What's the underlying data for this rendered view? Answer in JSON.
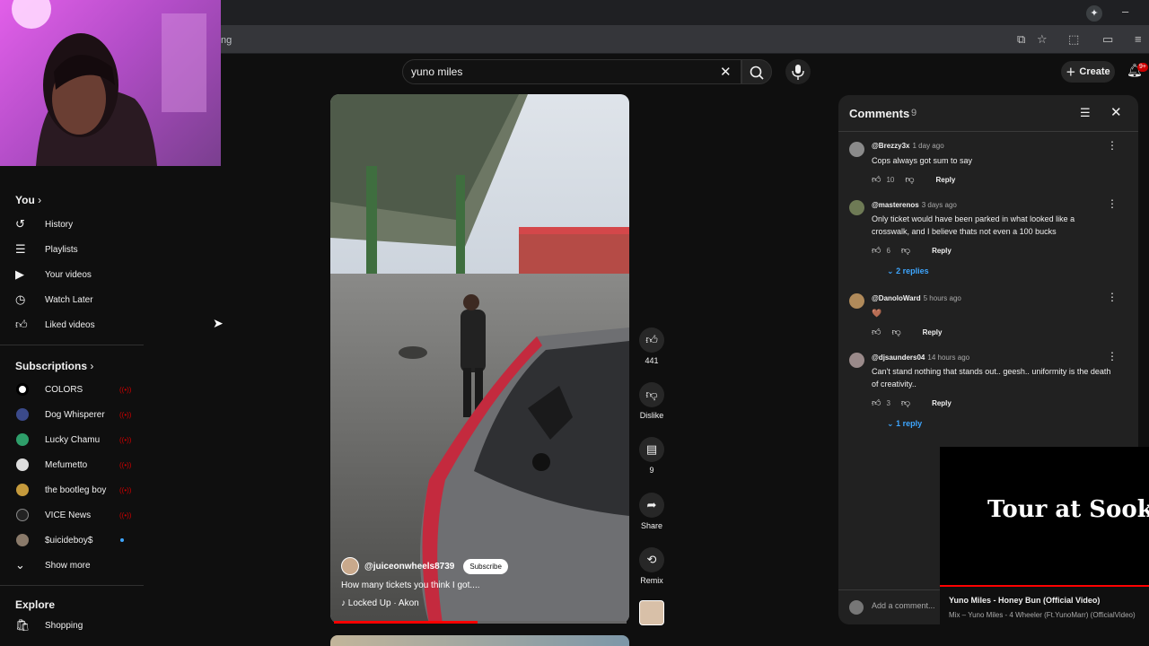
{
  "browser": {
    "address_fragment": "ng"
  },
  "header": {
    "search_value": "yuno miles",
    "create_label": "Create",
    "notification_badge": "9+"
  },
  "sidebar": {
    "you_label": "You",
    "you_items": [
      {
        "label": "History",
        "icon": "history-icon"
      },
      {
        "label": "Playlists",
        "icon": "playlists-icon"
      },
      {
        "label": "Your videos",
        "icon": "your-videos-icon"
      },
      {
        "label": "Watch Later",
        "icon": "clock-icon"
      },
      {
        "label": "Liked videos",
        "icon": "thumbs-up-icon"
      }
    ],
    "subscriptions_label": "Subscriptions",
    "subscriptions": [
      {
        "label": "COLORS",
        "avatar_color": "#ffffff",
        "indicator": "live"
      },
      {
        "label": "Dog Whisperer",
        "avatar_color": "#3b4a8a",
        "indicator": "live"
      },
      {
        "label": "Lucky Chamu",
        "avatar_color": "#2e9e6a",
        "indicator": "live"
      },
      {
        "label": "Mefumetto",
        "avatar_color": "#dddddd",
        "indicator": "live"
      },
      {
        "label": "the bootleg boy",
        "avatar_color": "#c59a3c",
        "indicator": "live"
      },
      {
        "label": "VICE News",
        "avatar_color": "#222222",
        "indicator": "live"
      },
      {
        "label": "$uicideboy$",
        "avatar_color": "#8a7a6a",
        "indicator": "new"
      }
    ],
    "show_more_label": "Show more",
    "explore_label": "Explore",
    "explore_items": [
      {
        "label": "Shopping",
        "icon": "shopping-bag-icon"
      }
    ]
  },
  "short": {
    "channel": "@juiceonwheels8739",
    "subscribe_label": "Subscribe",
    "title": "How many tickets you think I got....",
    "music": "Locked Up · Akon",
    "progress": 0.49,
    "actions": {
      "likes": "441",
      "dislike_label": "Dislike",
      "comments": "9",
      "share_label": "Share",
      "remix_label": "Remix"
    }
  },
  "comments_panel": {
    "title": "Comments",
    "count": "9",
    "items": [
      {
        "user": "@Brezzy3x",
        "time": "1 day ago",
        "text": "Cops always got sum to say",
        "likes": "10",
        "reply_label": "Reply",
        "avatar_color": "#8a8a8a"
      },
      {
        "user": "@masterenos",
        "time": "3 days ago",
        "text": "Only ticket would have been parked in what looked like a crosswalk, and I believe thats not even a 100 bucks",
        "likes": "6",
        "reply_label": "Reply",
        "replies": "2 replies",
        "avatar_color": "#6e7a55"
      },
      {
        "user": "@DanoloWard",
        "time": "5 hours ago",
        "text": "🤎",
        "likes": "",
        "reply_label": "Reply",
        "avatar_color": "#b08a5a"
      },
      {
        "user": "@djsaunders04",
        "time": "14 hours ago",
        "text": "Can't stand nothing that stands out.. geesh.. uniformity is the death of creativity..",
        "likes": "3",
        "reply_label": "Reply",
        "replies": "1 reply",
        "avatar_color": "#9a8a8a"
      }
    ],
    "add_placeholder": "Add a comment..."
  },
  "miniplayer": {
    "overlay_text": "Tour at Sook",
    "title": "Yuno Miles - Honey Bun (Official Video)",
    "subtitle": "Mix – Yuno Miles - 4 Wheeler (Ft.YunoMarr) (OfficialVideo)"
  }
}
